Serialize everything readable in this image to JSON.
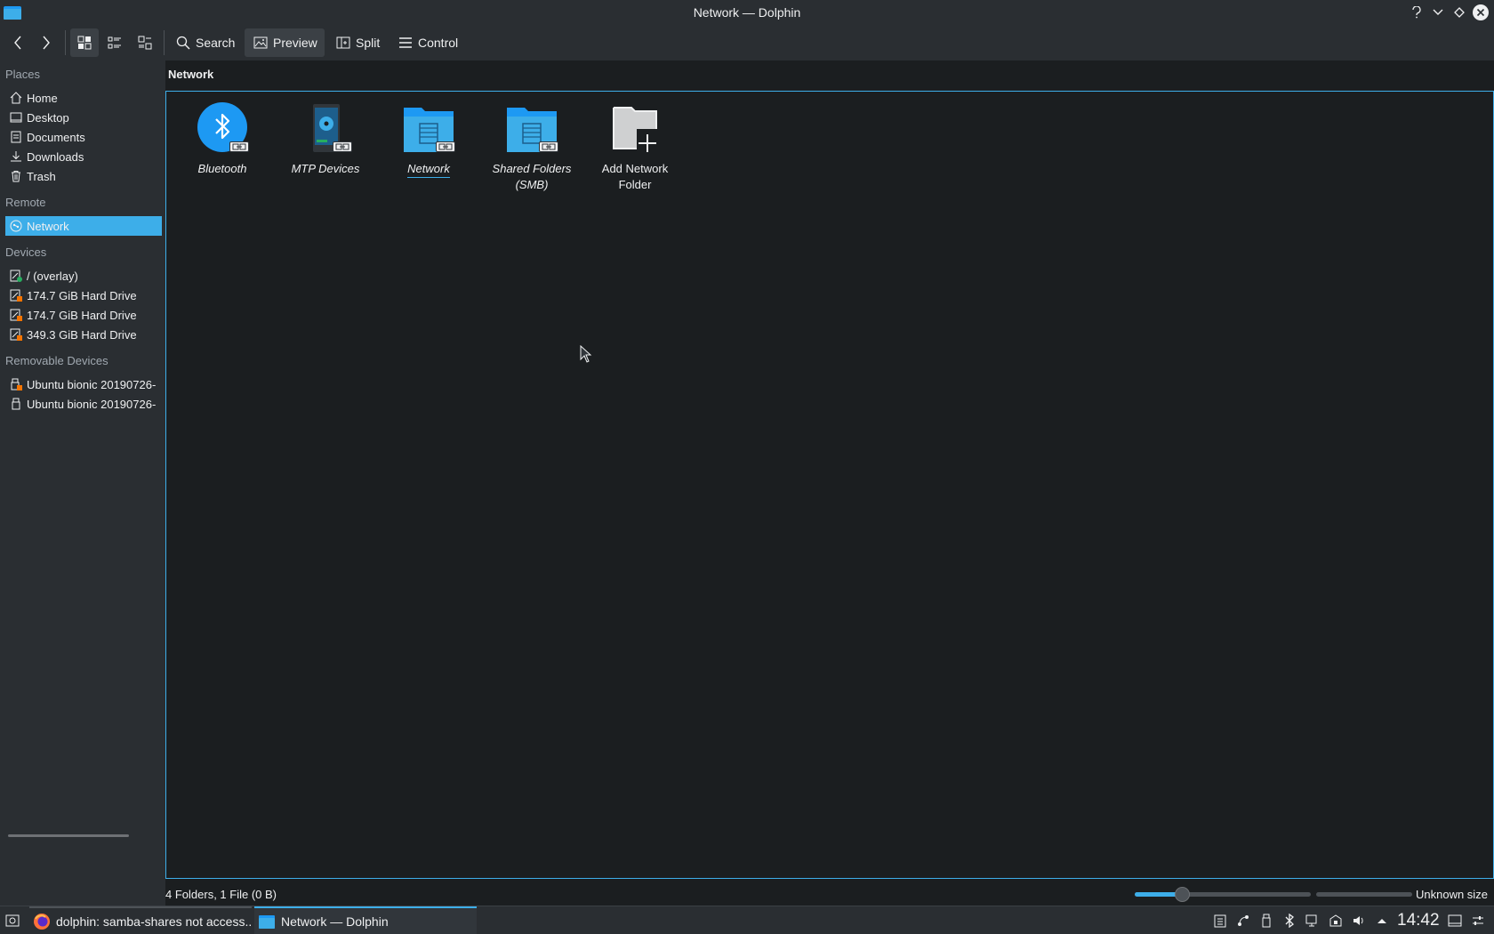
{
  "window": {
    "title": "Network — Dolphin",
    "buttons": [
      "help",
      "minimize",
      "maximize",
      "close"
    ]
  },
  "toolbar": {
    "search_label": "Search",
    "preview_label": "Preview",
    "split_label": "Split",
    "control_label": "Control"
  },
  "sidebar": {
    "places_header": "Places",
    "places": [
      {
        "label": "Home",
        "icon": "home-icon"
      },
      {
        "label": "Desktop",
        "icon": "desktop-icon"
      },
      {
        "label": "Documents",
        "icon": "documents-icon"
      },
      {
        "label": "Downloads",
        "icon": "downloads-icon"
      },
      {
        "label": "Trash",
        "icon": "trash-icon"
      }
    ],
    "remote_header": "Remote",
    "remote": [
      {
        "label": "Network",
        "icon": "network-icon",
        "selected": true
      }
    ],
    "devices_header": "Devices",
    "devices": [
      {
        "label": "/ (overlay)",
        "icon": "drive-icon"
      },
      {
        "label": "174.7 GiB Hard Drive",
        "icon": "drive-icon"
      },
      {
        "label": "174.7 GiB Hard Drive",
        "icon": "drive-icon"
      },
      {
        "label": "349.3 GiB Hard Drive",
        "icon": "drive-icon"
      }
    ],
    "removable_header": "Removable Devices",
    "removable": [
      {
        "label": "Ubuntu bionic 20190726-",
        "icon": "usb-icon"
      },
      {
        "label": "Ubuntu bionic 20190726-",
        "icon": "usb-icon"
      }
    ]
  },
  "location": "Network",
  "items": [
    {
      "label": "Bluetooth",
      "icon": "bluetooth-icon"
    },
    {
      "label": "MTP Devices",
      "icon": "mtp-device-icon"
    },
    {
      "label": "Network",
      "icon": "network-folder-icon"
    },
    {
      "label": "Shared Folders (SMB)",
      "icon": "network-folder-icon"
    },
    {
      "label": "Add Network Folder",
      "icon": "add-folder-icon"
    }
  ],
  "status": {
    "summary": "4 Folders, 1 File (0 B)",
    "zoom_fraction": 0.27,
    "space_label": "Unknown size"
  },
  "taskbar": {
    "tasks": [
      {
        "label": "dolphin: samba-shares not access...",
        "icon": "firefox-icon"
      },
      {
        "label": "Network — Dolphin",
        "icon": "dolphin-icon"
      }
    ],
    "clock": "14:42"
  },
  "colors": {
    "accent": "#3daee9",
    "background": "#1b1e20",
    "panel": "#2a2e32"
  }
}
